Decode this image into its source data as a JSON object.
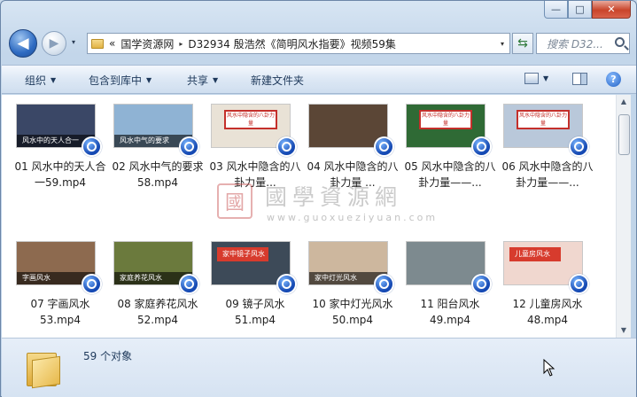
{
  "window": {
    "caption": {
      "minimize": "—",
      "maximize": "□",
      "close": "✕"
    }
  },
  "nav": {
    "back_icon": "back-arrow-icon",
    "forward_icon": "forward-arrow-icon",
    "dropdown": "▾"
  },
  "address": {
    "prefix": "«",
    "parts": [
      "国学资源网",
      "D32934  殷浩然《简明风水指要》视频59集"
    ],
    "separator": "▸"
  },
  "search": {
    "placeholder": "搜索 D32..."
  },
  "toolbar": {
    "organize": "组织",
    "include_in_library": "包含到库中",
    "share": "共享",
    "new_folder": "新建文件夹",
    "help": "?"
  },
  "files": [
    {
      "label": "01 风水中的天人合一59.mp4",
      "caption": "风水中的天人合一",
      "bg": "#3a4766"
    },
    {
      "label": "02 风水中气的要求58.mp4",
      "caption": "风水中气的要求",
      "bg": "#8fb3d4"
    },
    {
      "label": "03 风水中隐含的八卦力量...",
      "caption": "风水中隐含的八卦力量",
      "bg": "#e9e2d6"
    },
    {
      "label": "04 风水中隐含的八卦力量 ...",
      "caption": "",
      "bg": "#5b4636"
    },
    {
      "label": "05 风水中隐含的八卦力量——...",
      "caption": "风水中隐含的八卦力量",
      "bg": "#2f6a35"
    },
    {
      "label": "06 风水中隐含的八卦力量——...",
      "caption": "风水中隐含的八卦力量",
      "bg": "#b9c8da"
    },
    {
      "label": "07 字画风水53.mp4",
      "caption": "字画风水",
      "bg": "#8d6a4f"
    },
    {
      "label": "08 家庭养花风水52.mp4",
      "caption": "家庭养花风水",
      "bg": "#6b7a3d"
    },
    {
      "label": "09 镜子风水51.mp4",
      "caption": "家中镜子风水",
      "bg": "#3d4a58"
    },
    {
      "label": "10 家中灯光风水50.mp4",
      "caption": "家中灯光风水",
      "bg": "#cdb79e"
    },
    {
      "label": "11 阳台风水49.mp4",
      "caption": "",
      "bg": "#7d8a8f"
    },
    {
      "label": "12 儿童房风水48.mp4",
      "caption": "儿童房风水",
      "bg": "#f0d7cf"
    }
  ],
  "watermark": {
    "seal": "國",
    "title": "國學資源網",
    "url": "www.guoxueziyuan.com"
  },
  "details": {
    "count": "59 个对象"
  }
}
